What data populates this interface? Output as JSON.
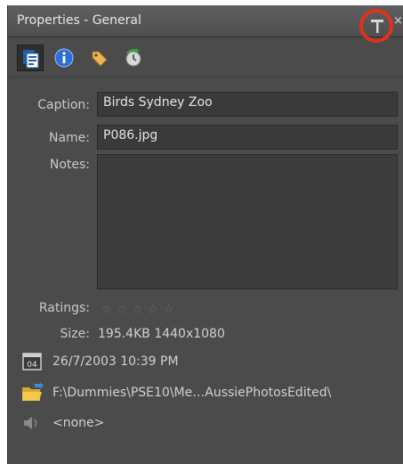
{
  "window": {
    "title": "Properties - General",
    "close_label": "×"
  },
  "toolbar": {
    "buttons": [
      {
        "name": "general",
        "icon": "document-properties-icon"
      },
      {
        "name": "metadata",
        "icon": "info-icon"
      },
      {
        "name": "keywords",
        "icon": "tag-icon"
      },
      {
        "name": "history",
        "icon": "history-icon"
      }
    ]
  },
  "fields": {
    "caption_label": "Caption:",
    "caption_value": "Birds Sydney Zoo",
    "name_label": "Name:",
    "name_value": "P086.jpg",
    "notes_label": "Notes:",
    "notes_value": ""
  },
  "details": {
    "ratings_label": "Ratings:",
    "ratings_stars": "☆☆☆☆☆",
    "size_label": "Size:",
    "size_value": "195.4KB  1440x1080",
    "date_value": "26/7/2003 10:39 PM",
    "calendar_day": "04",
    "path_value": "F:\\Dummies\\PSE10\\Me…AussiePhotosEdited\\",
    "audio_value": "<none>"
  },
  "colors": {
    "panel_bg": "#4b4b4b",
    "highlight_ring": "#e2311d"
  }
}
